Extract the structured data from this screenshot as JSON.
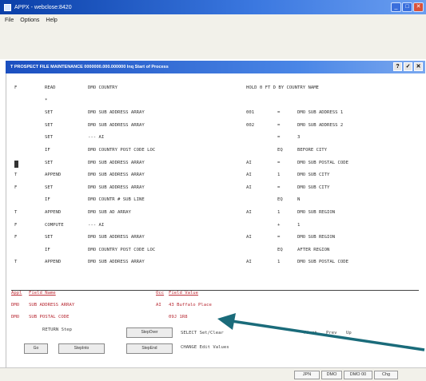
{
  "window": {
    "title": "APPX - webclose:8420",
    "minimize": "_",
    "maximize": "□",
    "close": "✕"
  },
  "menu": [
    "File",
    "Options",
    "Help"
  ],
  "panel": {
    "title": "T   PROSPECT FILE MAINTENANCE   0000000.000.000000 Inq Start of Process",
    "help_btn": "?",
    "check_btn": "✓",
    "close_btn": "✕"
  },
  "code_rows": [
    {
      "flag": "F",
      "op": "READ",
      "a": "DMO COUNTRY",
      "b": "HOLD 0 FT D BY COUNTRY NAME",
      "c": "",
      "d": "",
      "e": ""
    },
    {
      "flag": "",
      "op": "*",
      "a": "",
      "b": "",
      "c": "",
      "d": "",
      "e": ""
    },
    {
      "flag": "",
      "op": "SET",
      "a": "DMO SUB ADDRESS ARRAY",
      "b": "001",
      "c": "=",
      "d": "",
      "e": "DMO SUB ADDRESS 1"
    },
    {
      "flag": "",
      "op": "SET",
      "a": "DMO SUB ADDRESS ARRAY",
      "b": "002",
      "c": "=",
      "d": "",
      "e": "DMO SUB ADDRESS 2"
    },
    {
      "flag": "",
      "op": "SET",
      "a": "--- AI",
      "b": "",
      "c": "=",
      "d": "",
      "e": "3"
    },
    {
      "flag": "",
      "op": "IF",
      "a": "DMO COUNTRY POST CODE LOC",
      "b": "",
      "c": "EQ",
      "d": "",
      "e": "BEFORE CITY"
    },
    {
      "flag": "BLOCK",
      "op": "SET",
      "a": "DMO SUB ADDRESS ARRAY",
      "b": "AI",
      "c": "=",
      "d": "",
      "e": "DMO SUB POSTAL CODE"
    },
    {
      "flag": "T",
      "op": "APPEND",
      "a": "DMO SUB ADDRESS ARRAY",
      "b": "AI",
      "c": "1",
      "d": "",
      "e": "DMO SUB CITY"
    },
    {
      "flag": "F",
      "op": "SET",
      "a": "DMO SUB ADDRESS ARRAY",
      "b": "AI",
      "c": "=",
      "d": "",
      "e": "DMO SUB CITY"
    },
    {
      "flag": "",
      "op": "IF",
      "a": "DMO COUNTR      # SUB LINE",
      "b": "",
      "c": "EQ",
      "d": "",
      "e": "N"
    },
    {
      "flag": "T",
      "op": "APPEND",
      "a": "DMO SUB AD           ARRAY",
      "b": "AI",
      "c": "1",
      "d": "",
      "e": "DMO SUB REGION"
    },
    {
      "flag": "F",
      "op": "COMPUTE",
      "a": "--- AI",
      "b": "",
      "c": "+",
      "d": "",
      "e": "1"
    },
    {
      "flag": "F",
      "op": "SET",
      "a": "DMO SUB ADDRESS ARRAY",
      "b": "AI",
      "c": "=",
      "d": "",
      "e": "DMO SUB REGION"
    },
    {
      "flag": "",
      "op": "IF",
      "a": "DMO COUNTRY POST CODE LOC",
      "b": "",
      "c": "EQ",
      "d": "",
      "e": "AFTER REGION"
    },
    {
      "flag": "T",
      "op": "APPEND",
      "a": "DMO SUB ADDRESS ARRAY",
      "b": "AI",
      "c": "1",
      "d": "",
      "e": "DMO SUB POSTAL CODE"
    }
  ],
  "fields": {
    "headers": {
      "appl": "Appl",
      "field": "Field Name",
      "occ": "Occ",
      "value": "Field Value"
    },
    "rows": [
      {
        "appl": "DMO",
        "name": "SUB ADDRESS ARRAY",
        "occ": "AI",
        "value": "43 Buffalo Place"
      },
      {
        "appl": "DMO",
        "name": "SUB POSTAL CODE",
        "occ": "",
        "value": "09J 1R8"
      }
    ]
  },
  "controls": {
    "go": "Go",
    "return_step": "RETURN Step",
    "step_into": "StepInto",
    "step_over": "StepOver",
    "step_end": "StepEnd",
    "select_line": "SELECT Set/Clear",
    "first": "First",
    "prev": "Prev",
    "up": "Up",
    "change_line": "CHANGE Edit Values"
  },
  "status": [
    "JPN",
    "DMO",
    "DMO 00",
    "Chg"
  ],
  "colors": {
    "title_blue": "#1b4fc0",
    "field_red": "#b82a34",
    "arrow": "#1a6b7a"
  }
}
